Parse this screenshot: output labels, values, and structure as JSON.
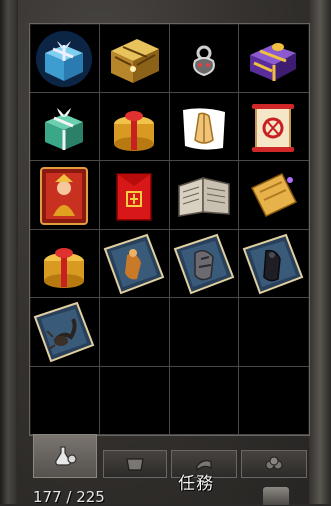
{
  "inventory": {
    "slots": [
      {
        "item": "blue-gift-box-icon"
      },
      {
        "item": "golden-treasure-chest-icon"
      },
      {
        "item": "silver-ornament-icon"
      },
      {
        "item": "purple-gift-box-icon"
      },
      {
        "item": "green-gift-box-icon"
      },
      {
        "item": "gold-round-gift-icon"
      },
      {
        "item": "praying-hands-icon"
      },
      {
        "item": "red-scroll-icon"
      },
      {
        "item": "fortune-card-icon"
      },
      {
        "item": "red-envelope-icon"
      },
      {
        "item": "open-book-icon"
      },
      {
        "item": "gold-ticket-icon"
      },
      {
        "item": "gold-round-gift-2-icon"
      },
      {
        "item": "costume-card-icon"
      },
      {
        "item": "armor-card-icon"
      },
      {
        "item": "dark-armor-card-icon"
      },
      {
        "item": "scorpion-card-icon"
      },
      {
        "item": "empty"
      },
      {
        "item": "empty"
      },
      {
        "item": "empty"
      },
      {
        "item": "empty"
      },
      {
        "item": "empty"
      },
      {
        "item": "empty"
      },
      {
        "item": "empty"
      }
    ],
    "count_text": "177 / 225"
  },
  "tabs": [
    {
      "name": "tab-items",
      "icon": "flask-icon",
      "active": true
    },
    {
      "name": "tab-equipment",
      "icon": "pot-icon",
      "active": false
    },
    {
      "name": "tab-quest",
      "icon": "scroll-icon",
      "active": false
    },
    {
      "name": "tab-misc",
      "icon": "cluster-icon",
      "active": false
    }
  ],
  "tab_label": "任務",
  "colors": {
    "grid_bg": "#000000",
    "grid_line": "#4b4845",
    "frame": "#35322f"
  }
}
